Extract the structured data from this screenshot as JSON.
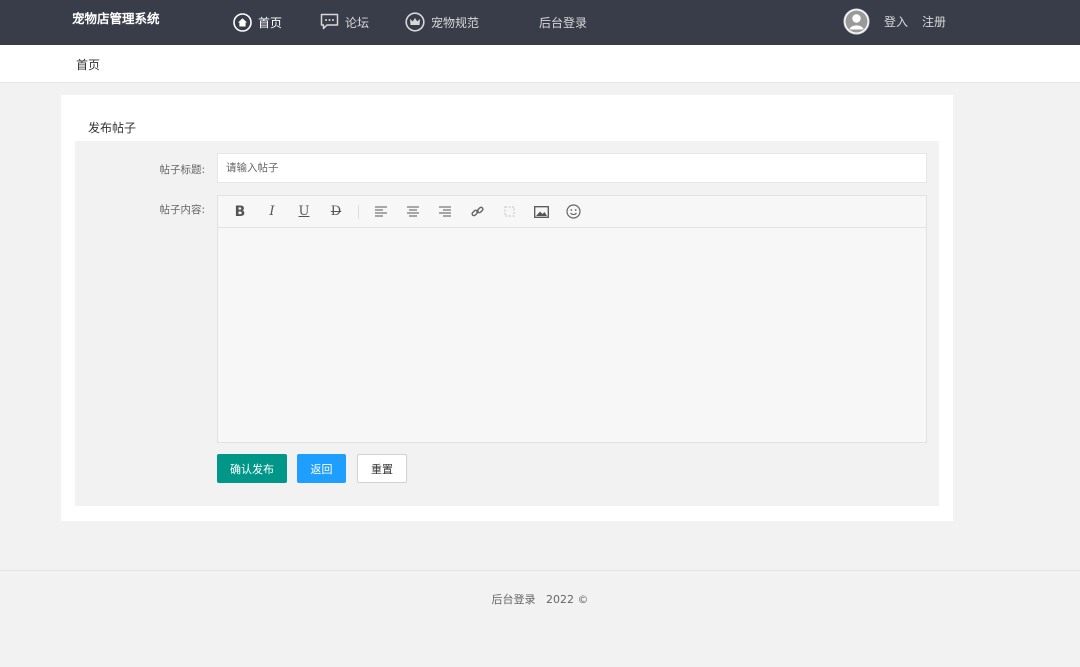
{
  "header": {
    "brand": "宠物店管理系统",
    "nav": [
      {
        "label": "首页",
        "icon": "home-icon",
        "active": true
      },
      {
        "label": "论坛",
        "icon": "chat-icon",
        "active": false
      },
      {
        "label": "宠物规范",
        "icon": "crown-icon",
        "active": false
      },
      {
        "label": "后台登录",
        "icon": "",
        "active": false
      }
    ],
    "login": "登入",
    "register": "注册"
  },
  "breadcrumb": "首页",
  "form": {
    "card_title": "发布帖子",
    "title_label": "帖子标题:",
    "title_placeholder": "请输入帖子",
    "title_value": "",
    "content_label": "帖子内容:",
    "toolbar_icons": [
      "bold-icon",
      "italic-icon",
      "underline-icon",
      "strikethrough-icon",
      "align-left-icon",
      "align-center-icon",
      "align-right-icon",
      "link-icon",
      "unlink-icon",
      "image-icon",
      "emoji-icon"
    ],
    "submit_label": "确认发布",
    "back_label": "返回",
    "reset_label": "重置"
  },
  "footer": {
    "text": "后台登录   2022 ©"
  },
  "colors": {
    "topbar": "#393d49",
    "primary": "#009688",
    "blue": "#1e9fff"
  }
}
